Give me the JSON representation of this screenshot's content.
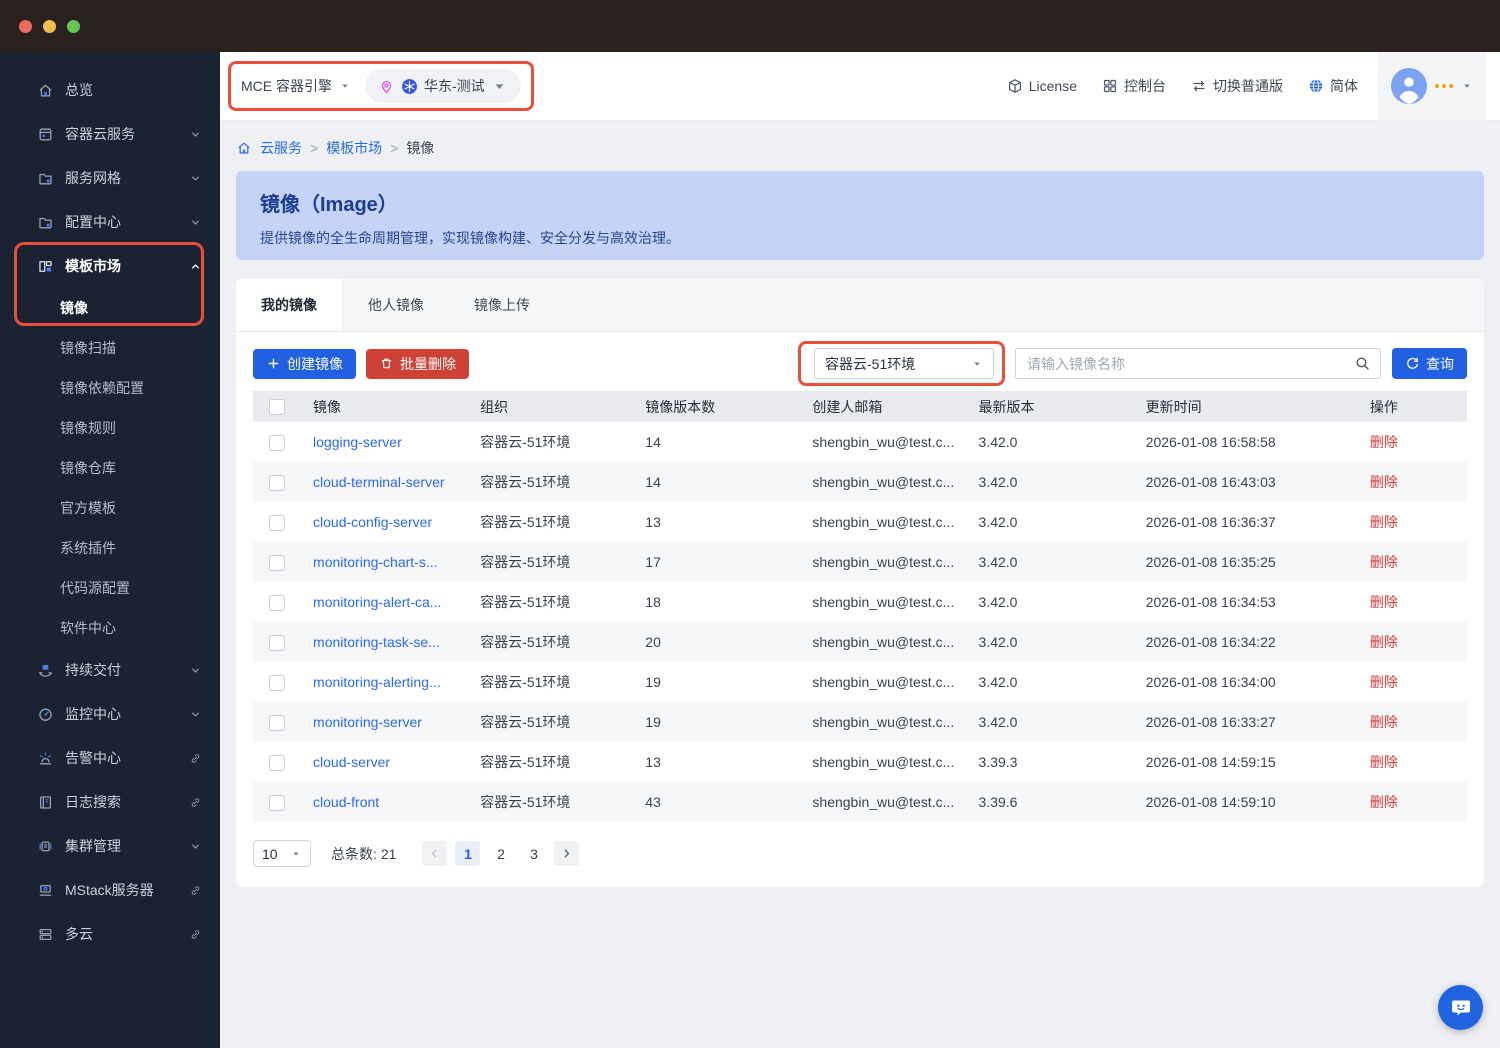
{
  "colors": {
    "accent": "#2160e0",
    "danger": "#cd4136",
    "annotation": "#e8503a",
    "link": "#2b6ae6",
    "banner_bg": "#c4d3f6",
    "banner_text": "#1d3d8f",
    "sidebar_bg": "#1b2332",
    "titlebar_bg": "#2a211e"
  },
  "header": {
    "product_label": "MCE 容器引擎",
    "environment_label": "华东-测试",
    "actions": [
      {
        "id": "license",
        "label": "License",
        "icon": "license"
      },
      {
        "id": "console",
        "label": "控制台",
        "icon": "console"
      },
      {
        "id": "switch-edition",
        "label": "切换普通版",
        "icon": "switch"
      },
      {
        "id": "language",
        "label": "简体",
        "icon": "globe"
      }
    ]
  },
  "sidebar": {
    "items": [
      {
        "label": "总览",
        "icon": "home"
      },
      {
        "label": "容器云服务",
        "icon": "app",
        "chevron": "down"
      },
      {
        "label": "服务网格",
        "icon": "mesh",
        "chevron": "down"
      },
      {
        "label": "配置中心",
        "icon": "config",
        "chevron": "down"
      },
      {
        "label": "模板市场",
        "icon": "template",
        "chevron": "up",
        "active": true
      },
      {
        "label": "镜像",
        "sub": true,
        "active": true
      },
      {
        "label": "镜像扫描",
        "sub": true
      },
      {
        "label": "镜像依赖配置",
        "sub": true
      },
      {
        "label": "镜像规则",
        "sub": true
      },
      {
        "label": "镜像仓库",
        "sub": true
      },
      {
        "label": "官方模板",
        "sub": true
      },
      {
        "label": "系统插件",
        "sub": true
      },
      {
        "label": "代码源配置",
        "sub": true
      },
      {
        "label": "软件中心",
        "sub": true
      },
      {
        "label": "持续交付",
        "icon": "delivery",
        "chevron": "down"
      },
      {
        "label": "监控中心",
        "icon": "monitor",
        "chevron": "down"
      },
      {
        "label": "告警中心",
        "icon": "alarm",
        "external": true
      },
      {
        "label": "日志搜索",
        "icon": "log",
        "external": true
      },
      {
        "label": "集群管理",
        "icon": "cluster",
        "chevron": "down"
      },
      {
        "label": "MStack服务器",
        "icon": "server",
        "external": true
      },
      {
        "label": "多云",
        "icon": "multicloud",
        "external": true
      }
    ]
  },
  "breadcrumb": {
    "items": [
      {
        "label": "云服务",
        "link": true
      },
      {
        "label": "模板市场",
        "link": true
      },
      {
        "label": "镜像",
        "link": false
      }
    ],
    "separator": ">"
  },
  "banner": {
    "title": "镜像（Image）",
    "description": "提供镜像的全生命周期管理，实现镜像构建、安全分发与高效治理。"
  },
  "tabs": [
    {
      "label": "我的镜像",
      "active": true
    },
    {
      "label": "他人镜像",
      "active": false
    },
    {
      "label": "镜像上传",
      "active": false
    }
  ],
  "toolbar": {
    "create_label": "创建镜像",
    "batch_delete_label": "批量删除",
    "env_filter_value": "容器云-51环境",
    "search_placeholder": "请输入镜像名称",
    "query_label": "查询"
  },
  "table": {
    "columns": [
      {
        "key": "select",
        "label": ""
      },
      {
        "key": "name",
        "label": "镜像"
      },
      {
        "key": "org",
        "label": "组织"
      },
      {
        "key": "versions",
        "label": "镜像版本数"
      },
      {
        "key": "email",
        "label": "创建人邮箱"
      },
      {
        "key": "latest",
        "label": "最新版本"
      },
      {
        "key": "updated",
        "label": "更新时间"
      },
      {
        "key": "action",
        "label": "操作"
      }
    ],
    "rows": [
      {
        "name": "logging-server",
        "org": "容器云-51环境",
        "versions": "14",
        "email": "shengbin_wu@test.c...",
        "latest": "3.42.0",
        "updated": "2026-01-08 16:58:58",
        "action": "删除"
      },
      {
        "name": "cloud-terminal-server",
        "org": "容器云-51环境",
        "versions": "14",
        "email": "shengbin_wu@test.c...",
        "latest": "3.42.0",
        "updated": "2026-01-08 16:43:03",
        "action": "删除"
      },
      {
        "name": "cloud-config-server",
        "org": "容器云-51环境",
        "versions": "13",
        "email": "shengbin_wu@test.c...",
        "latest": "3.42.0",
        "updated": "2026-01-08 16:36:37",
        "action": "删除"
      },
      {
        "name": "monitoring-chart-s...",
        "org": "容器云-51环境",
        "versions": "17",
        "email": "shengbin_wu@test.c...",
        "latest": "3.42.0",
        "updated": "2026-01-08 16:35:25",
        "action": "删除"
      },
      {
        "name": "monitoring-alert-ca...",
        "org": "容器云-51环境",
        "versions": "18",
        "email": "shengbin_wu@test.c...",
        "latest": "3.42.0",
        "updated": "2026-01-08 16:34:53",
        "action": "删除"
      },
      {
        "name": "monitoring-task-se...",
        "org": "容器云-51环境",
        "versions": "20",
        "email": "shengbin_wu@test.c...",
        "latest": "3.42.0",
        "updated": "2026-01-08 16:34:22",
        "action": "删除"
      },
      {
        "name": "monitoring-alerting...",
        "org": "容器云-51环境",
        "versions": "19",
        "email": "shengbin_wu@test.c...",
        "latest": "3.42.0",
        "updated": "2026-01-08 16:34:00",
        "action": "删除"
      },
      {
        "name": "monitoring-server",
        "org": "容器云-51环境",
        "versions": "19",
        "email": "shengbin_wu@test.c...",
        "latest": "3.42.0",
        "updated": "2026-01-08 16:33:27",
        "action": "删除"
      },
      {
        "name": "cloud-server",
        "org": "容器云-51环境",
        "versions": "13",
        "email": "shengbin_wu@test.c...",
        "latest": "3.39.3",
        "updated": "2026-01-08 14:59:15",
        "action": "删除"
      },
      {
        "name": "cloud-front",
        "org": "容器云-51环境",
        "versions": "43",
        "email": "shengbin_wu@test.c...",
        "latest": "3.39.6",
        "updated": "2026-01-08 14:59:10",
        "action": "删除"
      }
    ]
  },
  "pagination": {
    "page_size": "10",
    "total_label": "总条数:",
    "total": "21",
    "pages": [
      "1",
      "2",
      "3"
    ],
    "current": "1"
  }
}
